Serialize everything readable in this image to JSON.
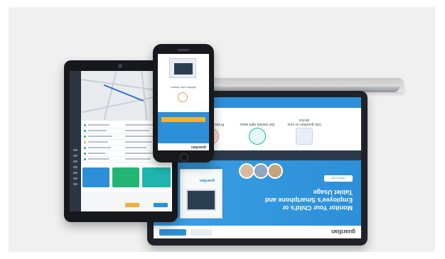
{
  "laptop": {
    "logo": "guardian",
    "hero_title": "Monitor Your Child's or Employee's Smartphone and Tablet Usage",
    "hero_subtitle": "",
    "hero_button": "Learn more",
    "box_label": "guardian",
    "strip_items": [
      "",
      "",
      ""
    ],
    "features": [
      {
        "label": "Use guardian on your device"
      },
      {
        "label": "Get started right away"
      },
      {
        "label": "Protect your child"
      }
    ]
  },
  "tablet": {
    "card_labels": [
      "",
      "",
      ""
    ]
  },
  "phone": {
    "logo": "guardian",
    "hero_text": "",
    "section_text": "Monitor your device"
  },
  "colors": {
    "accent": "#2d8fd7",
    "dark": "#2c3a4a",
    "yellow": "#f2b134",
    "green": "#22b573",
    "teal": "#1fb5ad"
  }
}
